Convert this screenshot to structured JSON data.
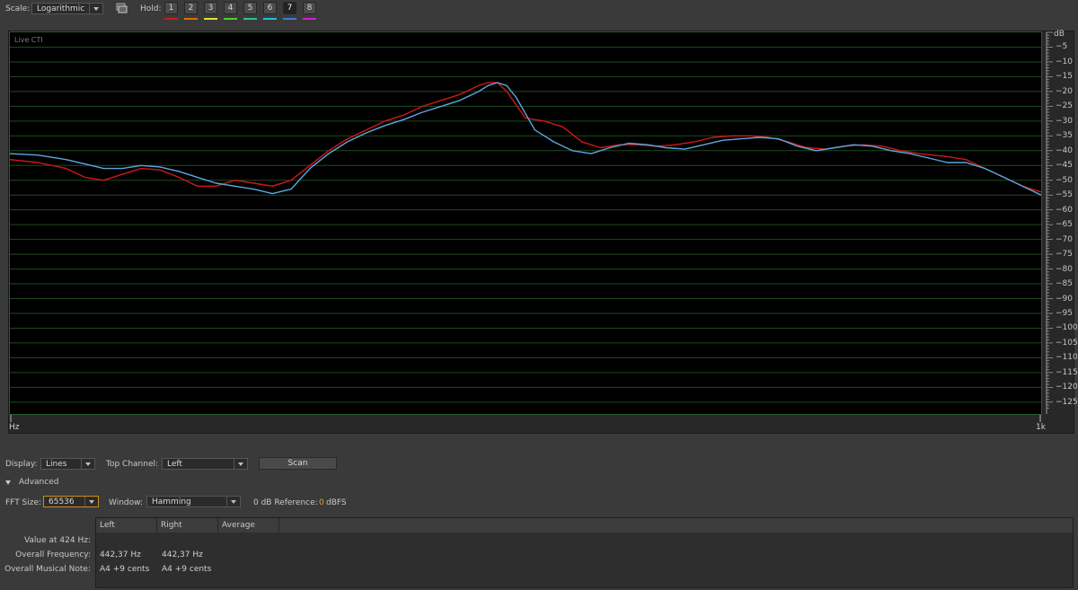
{
  "toolbar": {
    "scale_label": "Scale:",
    "scale_value": "Logarithmic",
    "hold_label": "Hold:",
    "hold_buttons": [
      {
        "label": "1",
        "color": "#d01818",
        "active": false
      },
      {
        "label": "2",
        "color": "#e07000",
        "active": false
      },
      {
        "label": "3",
        "color": "#e0e040",
        "active": false
      },
      {
        "label": "4",
        "color": "#50d030",
        "active": false
      },
      {
        "label": "5",
        "color": "#30c090",
        "active": false
      },
      {
        "label": "6",
        "color": "#20c0e0",
        "active": false
      },
      {
        "label": "7",
        "color": "#3a7ae0",
        "active": true
      },
      {
        "label": "8",
        "color": "#d020d0",
        "active": false
      }
    ]
  },
  "graph": {
    "overlay_label": "Live CTI",
    "x_start_label": "Hz",
    "x_end_label": "1k",
    "db_unit_label": "dB"
  },
  "chart_data": {
    "type": "line",
    "ylabel": "dB",
    "ylim": [
      -129,
      0
    ],
    "y_ticks": [
      -5,
      -10,
      -15,
      -20,
      -25,
      -30,
      -35,
      -40,
      -45,
      -50,
      -55,
      -60,
      -65,
      -70,
      -75,
      -80,
      -85,
      -90,
      -95,
      -100,
      -105,
      -110,
      -115,
      -120,
      -125
    ],
    "xscale": "logarithmic",
    "grid": true,
    "series": [
      {
        "color": "#d01818",
        "points": [
          [
            0,
            -43
          ],
          [
            0.03,
            -44
          ],
          [
            0.06,
            -46
          ],
          [
            0.08,
            -49
          ],
          [
            0.1,
            -50
          ],
          [
            0.12,
            -48
          ],
          [
            0.14,
            -46
          ],
          [
            0.16,
            -46.5
          ],
          [
            0.18,
            -49
          ],
          [
            0.2,
            -52
          ],
          [
            0.22,
            -52
          ],
          [
            0.24,
            -50
          ],
          [
            0.26,
            -51
          ],
          [
            0.28,
            -52
          ],
          [
            0.3,
            -50
          ],
          [
            0.32,
            -45
          ],
          [
            0.34,
            -40
          ],
          [
            0.36,
            -36
          ],
          [
            0.38,
            -33
          ],
          [
            0.4,
            -30
          ],
          [
            0.42,
            -28
          ],
          [
            0.44,
            -25
          ],
          [
            0.46,
            -23
          ],
          [
            0.48,
            -21
          ],
          [
            0.5,
            -18
          ],
          [
            0.51,
            -17
          ],
          [
            0.52,
            -17
          ],
          [
            0.53,
            -20
          ],
          [
            0.55,
            -29
          ],
          [
            0.57,
            -30
          ],
          [
            0.59,
            -32
          ],
          [
            0.61,
            -37
          ],
          [
            0.63,
            -39
          ],
          [
            0.65,
            -38
          ],
          [
            0.67,
            -38
          ],
          [
            0.69,
            -38.5
          ],
          [
            0.71,
            -38
          ],
          [
            0.73,
            -37
          ],
          [
            0.75,
            -35.5
          ],
          [
            0.77,
            -35
          ],
          [
            0.79,
            -35
          ],
          [
            0.81,
            -35.5
          ],
          [
            0.83,
            -37
          ],
          [
            0.85,
            -39
          ],
          [
            0.87,
            -39.5
          ],
          [
            0.89,
            -38.5
          ],
          [
            0.91,
            -38
          ],
          [
            0.93,
            -38.5
          ],
          [
            0.95,
            -40
          ],
          [
            0.97,
            -41
          ],
          [
            1.0,
            -42
          ],
          [
            1.02,
            -43
          ],
          [
            1.04,
            -46
          ],
          [
            1.06,
            -49
          ],
          [
            1.08,
            -52
          ],
          [
            1.1,
            -54
          ]
        ]
      },
      {
        "color": "#5aa8e0",
        "points": [
          [
            0,
            -41
          ],
          [
            0.03,
            -41.5
          ],
          [
            0.06,
            -43
          ],
          [
            0.08,
            -44.5
          ],
          [
            0.1,
            -46
          ],
          [
            0.12,
            -46
          ],
          [
            0.14,
            -45
          ],
          [
            0.16,
            -45.5
          ],
          [
            0.18,
            -47
          ],
          [
            0.2,
            -49
          ],
          [
            0.22,
            -51
          ],
          [
            0.24,
            -52
          ],
          [
            0.26,
            -53
          ],
          [
            0.28,
            -54.5
          ],
          [
            0.3,
            -53
          ],
          [
            0.32,
            -46
          ],
          [
            0.34,
            -41
          ],
          [
            0.36,
            -37
          ],
          [
            0.38,
            -34
          ],
          [
            0.4,
            -31.5
          ],
          [
            0.42,
            -29.5
          ],
          [
            0.44,
            -27
          ],
          [
            0.46,
            -25
          ],
          [
            0.48,
            -23
          ],
          [
            0.5,
            -20
          ],
          [
            0.51,
            -18
          ],
          [
            0.52,
            -17
          ],
          [
            0.53,
            -18
          ],
          [
            0.54,
            -22
          ],
          [
            0.56,
            -33
          ],
          [
            0.58,
            -37
          ],
          [
            0.6,
            -40
          ],
          [
            0.62,
            -41
          ],
          [
            0.64,
            -39
          ],
          [
            0.66,
            -37.5
          ],
          [
            0.68,
            -38
          ],
          [
            0.7,
            -39
          ],
          [
            0.72,
            -39.5
          ],
          [
            0.74,
            -38
          ],
          [
            0.76,
            -36.5
          ],
          [
            0.78,
            -36
          ],
          [
            0.8,
            -35.5
          ],
          [
            0.82,
            -36
          ],
          [
            0.84,
            -38.5
          ],
          [
            0.86,
            -40
          ],
          [
            0.88,
            -39
          ],
          [
            0.9,
            -38
          ],
          [
            0.92,
            -38.5
          ],
          [
            0.94,
            -40
          ],
          [
            0.96,
            -41
          ],
          [
            0.98,
            -42.5
          ],
          [
            1.0,
            -44
          ],
          [
            1.02,
            -44
          ],
          [
            1.04,
            -46
          ],
          [
            1.06,
            -49
          ],
          [
            1.08,
            -52
          ],
          [
            1.1,
            -55
          ]
        ]
      }
    ]
  },
  "controls": {
    "display_label": "Display:",
    "display_value": "Lines",
    "top_channel_label": "Top Channel:",
    "top_channel_value": "Left",
    "scan_label": "Scan",
    "advanced_label": "Advanced",
    "fft_label": "FFT Size:",
    "fft_value": "65536",
    "window_label": "Window:",
    "window_value": "Hamming",
    "ref_label": "0 dB Reference:",
    "ref_value": "0",
    "ref_unit": "dBFS"
  },
  "table": {
    "headers": [
      "Left",
      "Right",
      "Average"
    ],
    "rows": [
      {
        "label": "Value at 424 Hz:",
        "left": "",
        "right": "",
        "average": ""
      },
      {
        "label": "Overall Frequency:",
        "left": "442,37 Hz",
        "right": "442,37 Hz",
        "average": ""
      },
      {
        "label": "Overall Musical Note:",
        "left": "A4 +9 cents",
        "right": "A4 +9 cents",
        "average": ""
      }
    ]
  }
}
